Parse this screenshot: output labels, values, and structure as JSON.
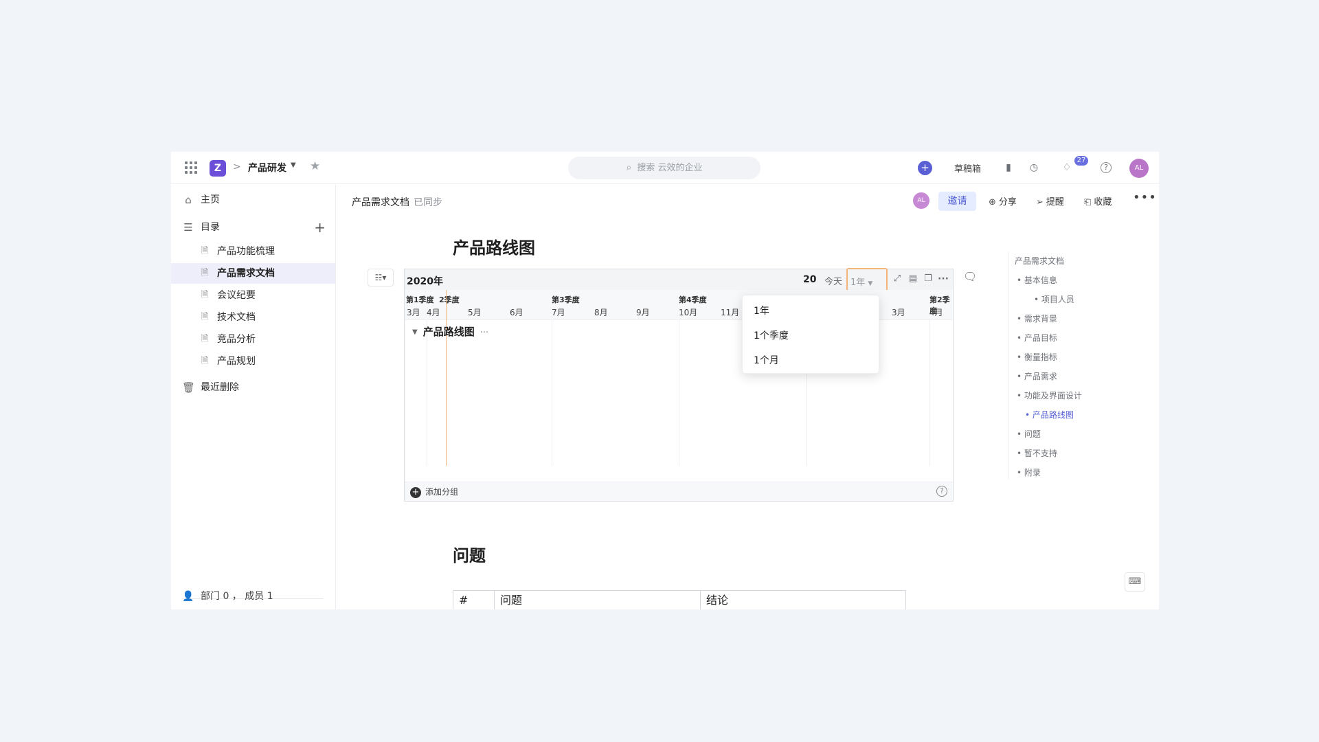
{
  "topbar": {
    "space_name": "产品研发",
    "breadcrumb_sep": ">",
    "search_placeholder": "搜索 云效的企业",
    "draft_label": "草稿箱",
    "notification_count": "27",
    "avatar_initials": "AL",
    "logo_glyph": "Z"
  },
  "sidebar": {
    "home": "主页",
    "catalog": "目录",
    "items": [
      {
        "label": "产品功能梳理"
      },
      {
        "label": "产品需求文档"
      },
      {
        "label": "会议纪要"
      },
      {
        "label": "技术文档"
      },
      {
        "label": "竞品分析"
      },
      {
        "label": "产品规划"
      }
    ],
    "recent_deleted": "最近删除",
    "footer": "部门 0 ， 成员 1",
    "active_index": 1
  },
  "header": {
    "doc_title": "产品需求文档",
    "sync_status": "已同步",
    "avatar_initials": "AL",
    "invite": "邀请",
    "share": "分享",
    "remind": "提醒",
    "favorite": "收藏"
  },
  "content": {
    "section1_title": "产品路线图",
    "section2_title": "问题"
  },
  "roadmap": {
    "year": "2020年",
    "year_right": "20",
    "today": "今天",
    "scale_value": "1年",
    "quarters": [
      "第1季度",
      "2季度",
      "第3季度",
      "第4季度",
      "第2季度"
    ],
    "months": [
      "3月",
      "4月",
      "5月",
      "6月",
      "7月",
      "8月",
      "9月",
      "10月",
      "11月",
      "3月",
      "4月"
    ],
    "group_name": "产品路线图",
    "add_group": "添加分组"
  },
  "dropdown": {
    "options": [
      "1年",
      "1个季度",
      "1个月"
    ]
  },
  "toc": {
    "items": [
      {
        "label": "产品需求文档",
        "level": 0
      },
      {
        "label": "基本信息",
        "level": 1
      },
      {
        "label": "项目人员",
        "level": 2
      },
      {
        "label": "需求背景",
        "level": 1
      },
      {
        "label": "产品目标",
        "level": 1
      },
      {
        "label": "衡量指标",
        "level": 1
      },
      {
        "label": "产品需求",
        "level": 1
      },
      {
        "label": "功能及界面设计",
        "level": 1
      },
      {
        "label": "产品路线图",
        "level": 2,
        "active": true
      },
      {
        "label": "问题",
        "level": 1
      },
      {
        "label": "暂不支持",
        "level": 1
      },
      {
        "label": "附录",
        "level": 1
      }
    ]
  },
  "table": {
    "headers": [
      "#",
      "问题",
      "结论"
    ]
  },
  "colors": {
    "accent": "#5b5fd6",
    "logo": "#6b4fd8",
    "today_line": "#f3b57c",
    "active_bg": "#eeeefa"
  }
}
